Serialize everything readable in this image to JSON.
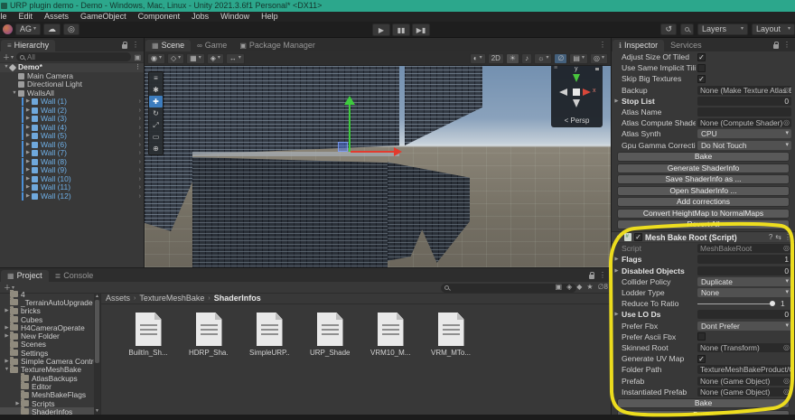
{
  "window": {
    "title": "URP plugin demo - Demo - Windows, Mac, Linux - Unity 2021.3.6f1 Personal* <DX11>"
  },
  "menu": {
    "items": [
      "File",
      "Edit",
      "Assets",
      "GameObject",
      "Component",
      "Jobs",
      "Window",
      "Help"
    ]
  },
  "toolbar": {
    "account_label": "AG",
    "layers_label": "Layers",
    "layout_label": "Layout"
  },
  "hierarchy": {
    "tab": "Hierarchy",
    "search_placeholder": "All",
    "rows": [
      {
        "label": "Demo*",
        "type": "scene",
        "depth": 0,
        "fold": "open"
      },
      {
        "label": "Main Camera",
        "type": "item",
        "depth": 1
      },
      {
        "label": "Directional Light",
        "type": "item",
        "depth": 1
      },
      {
        "label": "WallsAll",
        "type": "item",
        "depth": 1,
        "fold": "open"
      },
      {
        "label": "Wall (1)",
        "type": "wall",
        "depth": 2,
        "fold": "closed"
      },
      {
        "label": "Wall (2)",
        "type": "wall",
        "depth": 2,
        "fold": "closed"
      },
      {
        "label": "Wall (3)",
        "type": "wall",
        "depth": 2,
        "fold": "closed"
      },
      {
        "label": "Wall (4)",
        "type": "wall",
        "depth": 2,
        "fold": "closed"
      },
      {
        "label": "Wall (5)",
        "type": "wall",
        "depth": 2,
        "fold": "closed"
      },
      {
        "label": "Wall (6)",
        "type": "wall",
        "depth": 2,
        "fold": "closed"
      },
      {
        "label": "Wall (7)",
        "type": "wall",
        "depth": 2,
        "fold": "closed"
      },
      {
        "label": "Wall (8)",
        "type": "wall",
        "depth": 2,
        "fold": "closed"
      },
      {
        "label": "Wall (9)",
        "type": "wall",
        "depth": 2,
        "fold": "closed"
      },
      {
        "label": "Wall (10)",
        "type": "wall",
        "depth": 2,
        "fold": "closed"
      },
      {
        "label": "Wall (11)",
        "type": "wall",
        "depth": 2,
        "fold": "closed"
      },
      {
        "label": "Wall (12)",
        "type": "wall",
        "depth": 2,
        "fold": "closed"
      }
    ]
  },
  "scene": {
    "tabs": [
      "Scene",
      "Game",
      "Package Manager"
    ],
    "active_tab": "Scene",
    "toolbar_2d_label": "2D",
    "persp_label": "< Persp",
    "axis_x_label": "x",
    "axis_y_label": "y",
    "tools": [
      "menu",
      "hand-tool",
      "move-tool",
      "rotate-tool",
      "scale-tool",
      "rect-tool",
      "transform-tool"
    ],
    "selected_tool": "move-tool",
    "toolbar_left": [
      {
        "name": "scene-camera-settings",
        "caret": true
      },
      {
        "name": "gizmos-3d-icons",
        "caret": true
      },
      {
        "name": "grid-settings",
        "caret": true
      },
      {
        "name": "snap-settings",
        "caret": true
      },
      {
        "name": "tool-handle",
        "caret": true
      }
    ],
    "toolbar_right": [
      {
        "name": "shading-mode",
        "caret": true
      },
      {
        "name": "2d-toggle",
        "label": "2D"
      },
      {
        "name": "lighting-toggle",
        "active": true
      },
      {
        "name": "audio-toggle"
      },
      {
        "name": "effects-toggle",
        "caret": true
      },
      {
        "name": "scene-visibility",
        "activeblue": true
      },
      {
        "name": "camera-overlay",
        "caret": true
      },
      {
        "name": "gizmos-toggle",
        "caret": true
      }
    ]
  },
  "inspector": {
    "tabs": [
      "Inspector",
      "Services"
    ],
    "section1": {
      "rows": [
        {
          "label": "Adjust Size Of Tiled",
          "type": "checkbox",
          "checked": true
        },
        {
          "label": "Use Same Implicit Tili",
          "type": "checkbox",
          "checked": false
        },
        {
          "label": "Skip Big Textures",
          "type": "checkbox",
          "checked": true
        },
        {
          "label": "Backup",
          "type": "object",
          "value": "None (Make Texture Atlas Bkp)"
        },
        {
          "label": "Stop List",
          "type": "number",
          "value": "0",
          "fold": true,
          "bold": true
        },
        {
          "label": "Atlas Name",
          "type": "text",
          "value": ""
        },
        {
          "label": "Atlas Compute Shade",
          "type": "object",
          "value": "None (Compute Shader)"
        },
        {
          "label": "Atlas Synth",
          "type": "dropdown",
          "value": "CPU"
        },
        {
          "label": "Gpu Gamma Correctio",
          "type": "dropdown",
          "value": "Do Not Touch"
        }
      ],
      "buttons": [
        "Bake",
        "Generate ShaderInfo",
        "Save ShaderInfo as ...",
        "Open ShaderInfo ...",
        "Add corrections",
        "Convert HeightMap to NormalMaps",
        "Revert All"
      ]
    },
    "component": {
      "title": "Mesh Bake Root (Script)",
      "enabled": true,
      "rows": [
        {
          "label": "Script",
          "type": "script",
          "value": "MeshBakeRoot",
          "dim": true
        },
        {
          "label": "Flags",
          "type": "number",
          "value": "1",
          "fold": true,
          "bold": true
        },
        {
          "label": "Disabled Objects",
          "type": "number",
          "value": "0",
          "fold": true,
          "bold": true
        },
        {
          "label": "Collider Policy",
          "type": "dropdown",
          "value": "Duplicate"
        },
        {
          "label": "Lodder Type",
          "type": "dropdown",
          "value": "None"
        },
        {
          "label": "Reduce To Ratio",
          "type": "slider",
          "value": "1"
        },
        {
          "label": "Use LO Ds",
          "type": "number",
          "value": "0",
          "fold": true,
          "bold": true
        },
        {
          "label": "Prefer Fbx",
          "type": "dropdown",
          "value": "Dont Prefer"
        },
        {
          "label": "Prefer Ascii Fbx",
          "type": "checkbox",
          "checked": false
        },
        {
          "label": "Skinned Root",
          "type": "object",
          "value": "None (Transform)"
        },
        {
          "label": "Generate UV Map",
          "type": "checkbox",
          "checked": true
        },
        {
          "label": "Folder Path",
          "type": "text",
          "value": "TextureMeshBakeProduct/Combir"
        },
        {
          "label": "Prefab",
          "type": "object",
          "value": "None (Game Object)"
        },
        {
          "label": "Instantiated Prefab",
          "type": "object",
          "value": "None (Game Object)"
        }
      ],
      "buttons": [
        "Bake",
        "Purge"
      ]
    }
  },
  "project": {
    "tabs": [
      "Project",
      "Console"
    ],
    "hidden_count": "8",
    "folders": [
      {
        "label": "4",
        "depth": 1
      },
      {
        "label": "_TerrainAutoUpgrade",
        "depth": 1
      },
      {
        "label": "bricks",
        "depth": 1,
        "fold": "closed"
      },
      {
        "label": "Cubes",
        "depth": 1
      },
      {
        "label": "H4CameraOperate",
        "depth": 1,
        "fold": "closed"
      },
      {
        "label": "New Folder",
        "depth": 1,
        "fold": "closed"
      },
      {
        "label": "Scenes",
        "depth": 1
      },
      {
        "label": "Settings",
        "depth": 1
      },
      {
        "label": "Simple Camera Controller",
        "depth": 1,
        "fold": "closed"
      },
      {
        "label": "TextureMeshBake",
        "depth": 1,
        "fold": "open"
      },
      {
        "label": "AtlasBackups",
        "depth": 2
      },
      {
        "label": "Editor",
        "depth": 2
      },
      {
        "label": "MeshBakeFlags",
        "depth": 2
      },
      {
        "label": "Scripts",
        "depth": 2,
        "fold": "closed"
      },
      {
        "label": "ShaderInfos",
        "depth": 2,
        "selected": true
      }
    ],
    "breadcrumb": [
      "Assets",
      "TextureMeshBake",
      "ShaderInfos"
    ],
    "files": [
      "BuiltIn_Sh...",
      "HDRP_Sha...",
      "SimpleURP...",
      "URP_Shade...",
      "VRM10_M...",
      "VRM_MTo..."
    ]
  },
  "colors": {
    "titlebar": "#2ca78c",
    "annotation_yellow": "#f6e51c",
    "prefab_blue": "#6fb0e8",
    "selection_blue": "#3d7dbf"
  }
}
